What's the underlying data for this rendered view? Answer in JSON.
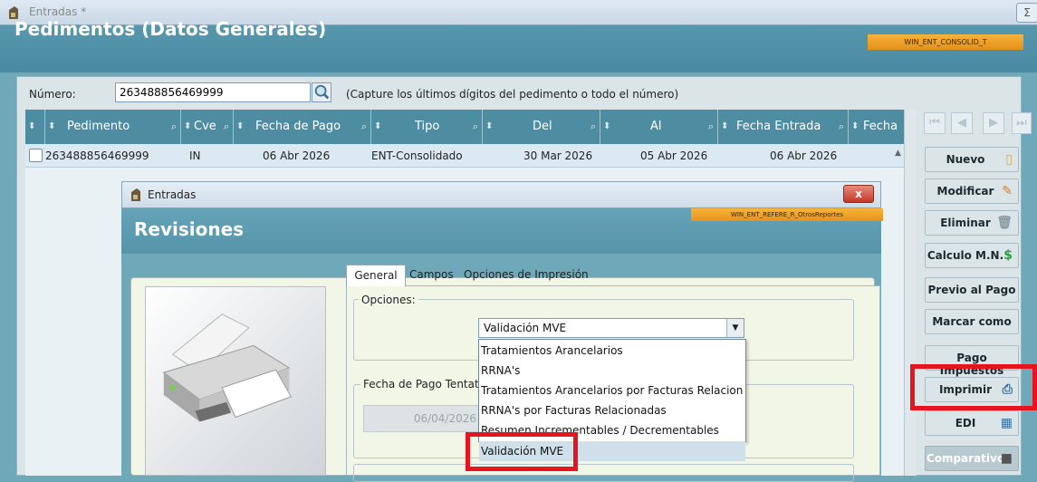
{
  "window": {
    "title": "Entradas *",
    "close_glyph": "Σ"
  },
  "header": {
    "title": "Pedimentos (Datos Generales)",
    "code": "WIN_ENT_CONSOLID_T"
  },
  "search": {
    "label": "Número:",
    "value": "263488856469999",
    "hint": "(Capture los últimos dígitos del pedimento o todo el número)"
  },
  "grid": {
    "columns": [
      "Pedimento",
      "Cve",
      "Fecha de Pago",
      "Tipo",
      "Del",
      "Al",
      "Fecha Entrada",
      "Fecha"
    ],
    "rows": [
      {
        "pedimento": "263488856469999",
        "cve": "IN",
        "fecha_pago": "06 Abr 2026",
        "tipo": "ENT-Consolidado",
        "del": "30 Mar 2026",
        "al": "05 Abr 2026",
        "fecha_entrada": "06 Abr 2026"
      }
    ]
  },
  "side_buttons": {
    "nuevo": "Nuevo",
    "modificar": "Modificar",
    "eliminar": "Eliminar",
    "calculo": "Calculo M.N.",
    "previo": "Previo al Pago",
    "marcar": "Marcar como",
    "pago": "Pago Impuestos",
    "imprimir": "Imprimir",
    "edi": "EDI",
    "comparativo": "Comparativo"
  },
  "dialog": {
    "title": "Entradas",
    "close_glyph": "x",
    "header_title": "Revisiones",
    "code": "WIN_ENT_REFERE_R_OtrosReportes",
    "tabs": [
      "General",
      "Campos",
      "Opciones de Impresión"
    ],
    "opciones_label": "Opciones:",
    "combo_value": "Validación MVE",
    "dropdown_items": [
      "Tratamientos Arancelarios",
      "RRNA's",
      "Tratamientos Arancelarios por Facturas Relacionadas",
      "RRNA's por Facturas Relacionadas",
      "Resumen Incrementables / Decrementables",
      "Validación MVE"
    ],
    "fecha_label": "Fecha de Pago Tentativa:",
    "fecha_value": "06/04/2026"
  },
  "colors": {
    "highlight": "#e6141e",
    "header": "#4e8ca2",
    "badge": "#f0a42a"
  }
}
